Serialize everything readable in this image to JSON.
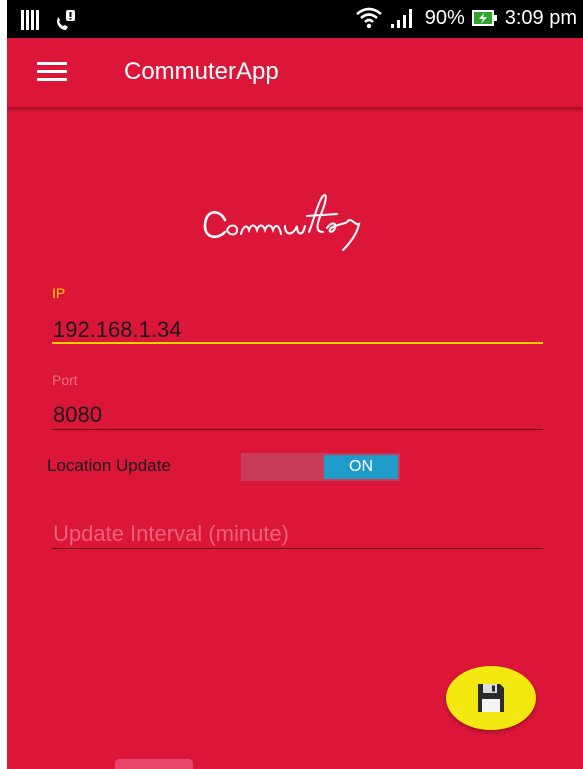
{
  "status_bar": {
    "battery_percent": "90%",
    "time": "3:09 pm"
  },
  "app_bar": {
    "title": "CommuterApp",
    "menu_icon": "menu-icon"
  },
  "logo_text": "Commuter",
  "form": {
    "ip": {
      "label": "IP",
      "value": "192.168.1.34"
    },
    "port": {
      "label": "Port",
      "value": "8080"
    },
    "location_update": {
      "label": "Location Update",
      "state_label": "ON"
    },
    "update_interval": {
      "placeholder": "Update Interval (minute)",
      "value": ""
    }
  },
  "save_button": {
    "icon": "save-icon"
  },
  "colors": {
    "background": "#dc1639",
    "accent_focus": "#ffd200",
    "toggle_on": "#1f9bc9",
    "fab": "#f3e80f"
  }
}
